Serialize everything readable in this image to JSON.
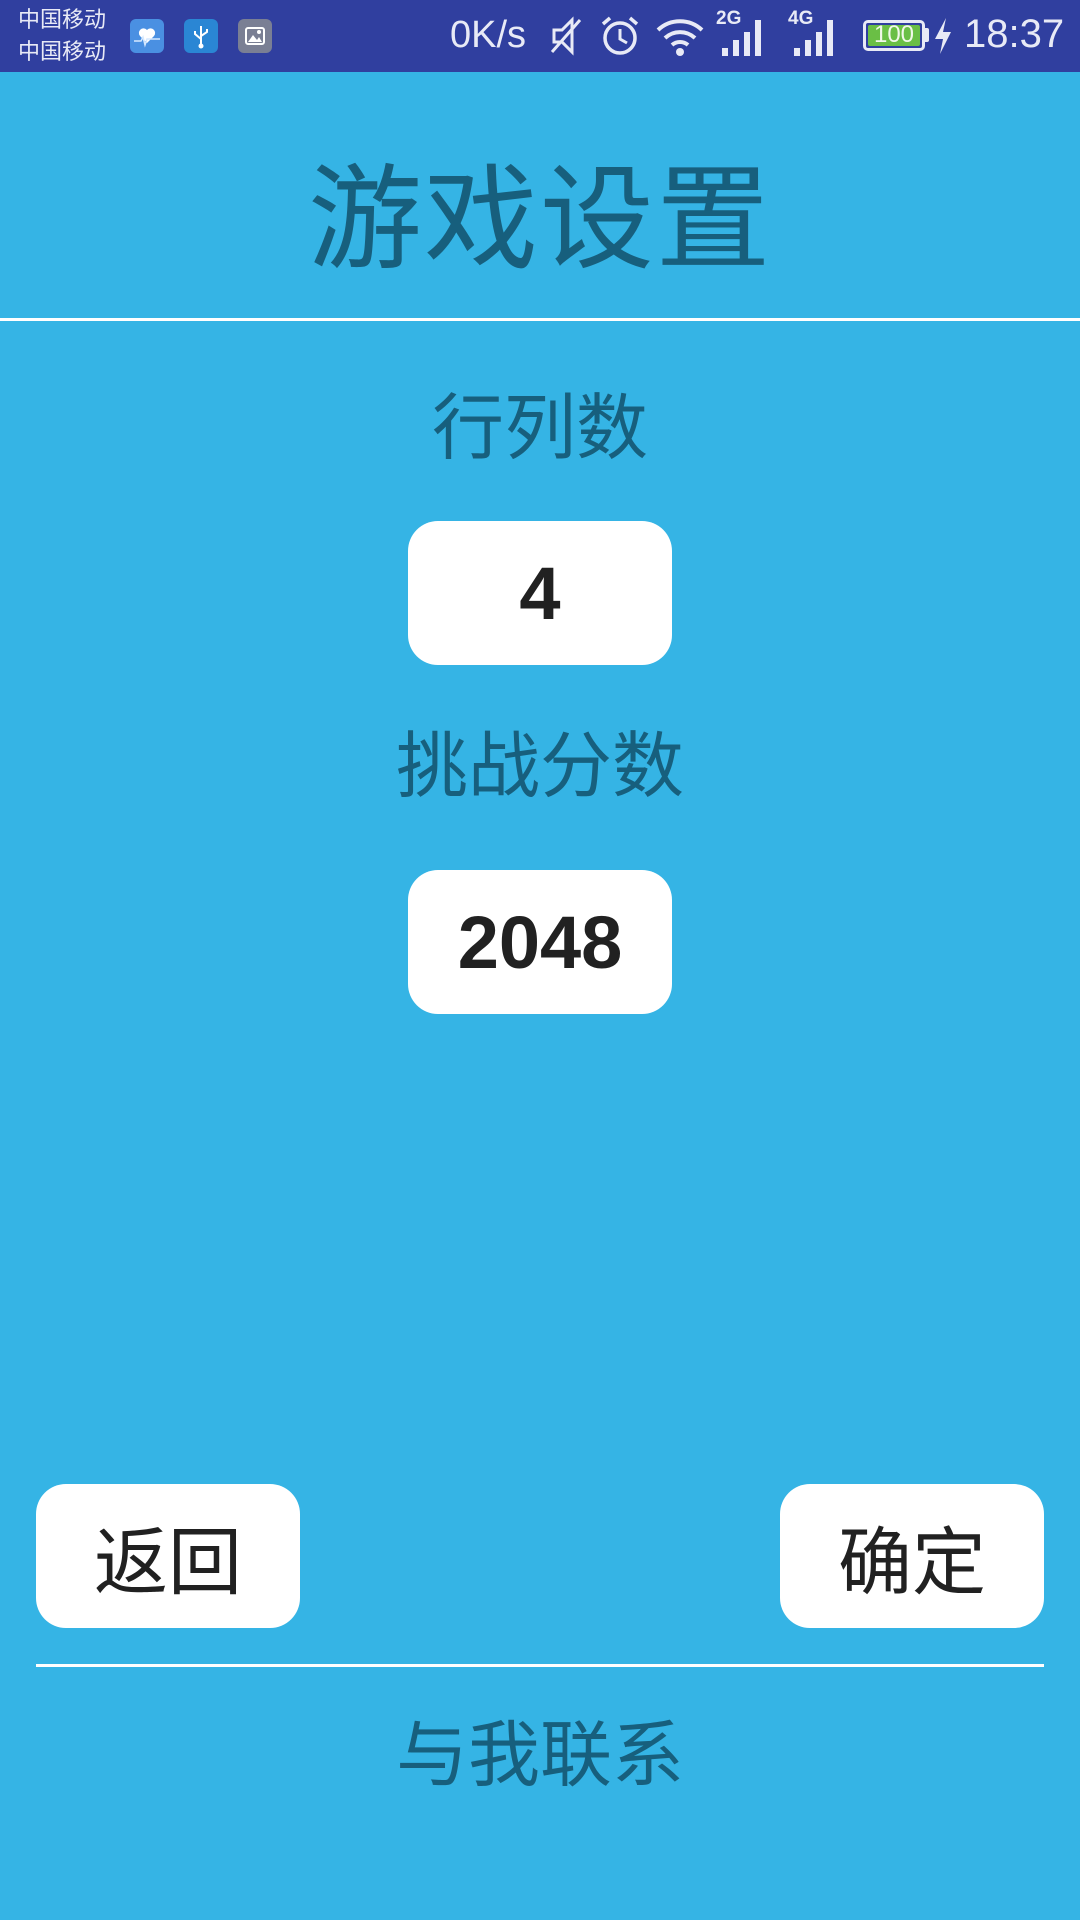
{
  "status_bar": {
    "carrier_1": "中国移动",
    "carrier_2": "中国移动",
    "notification_icons": [
      "health-app-icon",
      "usb-icon",
      "gallery-icon"
    ],
    "net_speed": "0K/s",
    "icons": [
      "mute-icon",
      "alarm-icon",
      "wifi-icon",
      "signal-icon",
      "signal-icon",
      "battery-icon",
      "charging-icon"
    ],
    "signal_1_type": "2G",
    "signal_2_type": "4G",
    "battery_level": "100",
    "time": "18:37",
    "colors": {
      "background": "#303f9f",
      "battery_fill": "#6abf45"
    }
  },
  "page": {
    "title": "游戏设置",
    "background_color": "#35b4e5",
    "text_color": "#175f7d"
  },
  "settings": {
    "rows_label": "行列数",
    "rows_value": "4",
    "score_label": "挑战分数",
    "score_value": "2048"
  },
  "actions": {
    "back_label": "返回",
    "confirm_label": "确定"
  },
  "footer": {
    "contact_label": "与我联系"
  }
}
